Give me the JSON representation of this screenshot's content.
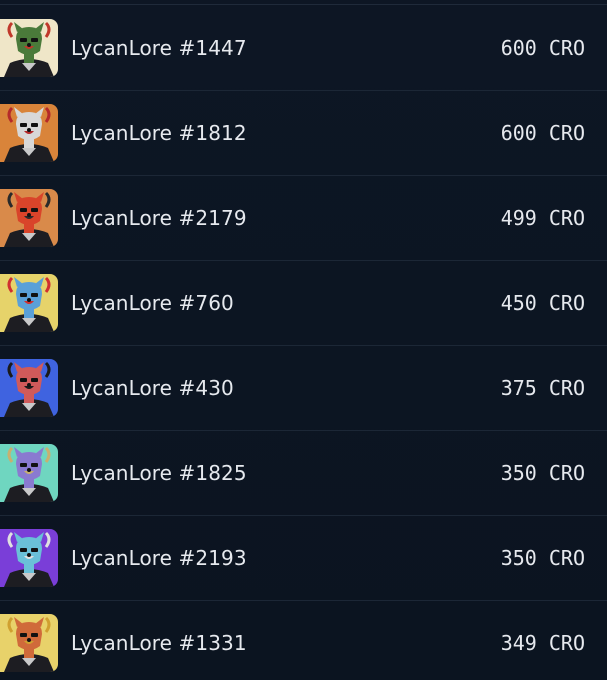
{
  "listings": [
    {
      "name": "LycanLore #1447",
      "price": "600 CRO",
      "thumb_bg": "#efe6c8",
      "face": "#4a7a3a",
      "accent": "#c0392b"
    },
    {
      "name": "LycanLore #1812",
      "price": "600 CRO",
      "thumb_bg": "#d9843a",
      "face": "#d8d8d8",
      "accent": "#b52a2a"
    },
    {
      "name": "LycanLore #2179",
      "price": "499 CRO",
      "thumb_bg": "#d98a4a",
      "face": "#d9442a",
      "accent": "#2a2a2a"
    },
    {
      "name": "LycanLore #760",
      "price": "450 CRO",
      "thumb_bg": "#e6d36a",
      "face": "#5aa0d8",
      "accent": "#d03030"
    },
    {
      "name": "LycanLore #430",
      "price": "375 CRO",
      "thumb_bg": "#3f63e0",
      "face": "#d05a5a",
      "accent": "#1a1a1a"
    },
    {
      "name": "LycanLore #1825",
      "price": "350 CRO",
      "thumb_bg": "#6fd6c0",
      "face": "#8a7ad0",
      "accent": "#c8b070"
    },
    {
      "name": "LycanLore #2193",
      "price": "350 CRO",
      "thumb_bg": "#7a3ed8",
      "face": "#6ac0d8",
      "accent": "#e0e0e0"
    },
    {
      "name": "LycanLore #1331",
      "price": "349 CRO",
      "thumb_bg": "#e8d26a",
      "face": "#d06a3a",
      "accent": "#d0a030"
    }
  ]
}
